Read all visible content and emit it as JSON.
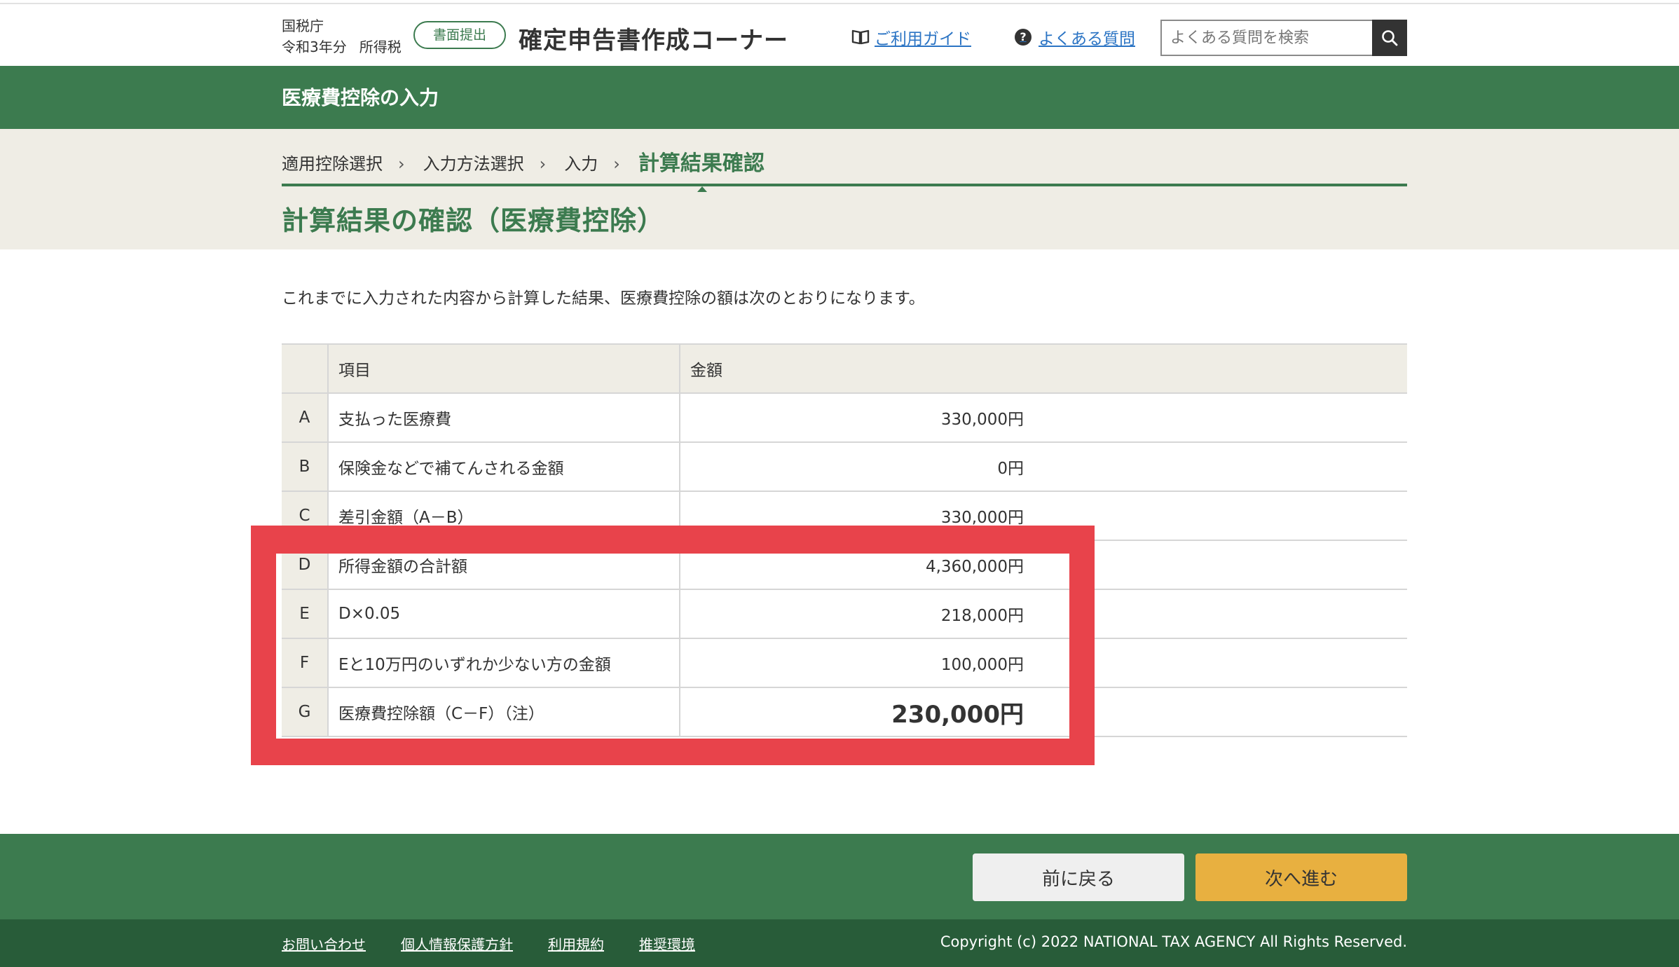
{
  "header": {
    "agency": "国税庁",
    "year": "令和3年分",
    "tax": "所得税",
    "badge": "書面提出",
    "title": "確定申告書作成コーナー",
    "guide_link": "ご利用ガイド",
    "faq_link": "よくある質問",
    "search_placeholder": "よくある質問を検索"
  },
  "banner": {
    "title": "医療費控除の入力"
  },
  "breadcrumb": [
    "適用控除選択",
    "入力方法選択",
    "入力",
    "計算結果確認"
  ],
  "page_title": "計算結果の確認（医療費控除）",
  "lead": "これまでに入力された内容から計算した結果、医療費控除の額は次のとおりになります。",
  "table": {
    "headers": {
      "item": "項目",
      "amount": "金額"
    },
    "rows": [
      {
        "key": "A",
        "item": "支払った医療費",
        "amount": "330,000円"
      },
      {
        "key": "B",
        "item": "保険金などで補てんされる金額",
        "amount": "0円"
      },
      {
        "key": "C",
        "item": "差引金額（A－B）",
        "amount": "330,000円"
      },
      {
        "key": "D",
        "item": "所得金額の合計額",
        "amount": "4,360,000円"
      },
      {
        "key": "E",
        "item": "D×0.05",
        "amount": "218,000円"
      },
      {
        "key": "F",
        "item": "Eと10万円のいずれか少ない方の金額",
        "amount": "100,000円"
      },
      {
        "key": "G",
        "item": "医療費控除額（C－F）（注）",
        "amount": "230,000円"
      }
    ]
  },
  "nav": {
    "back": "前に戻る",
    "next": "次へ進む"
  },
  "footer": {
    "links": [
      "お問い合わせ",
      "個人情報保護方針",
      "利用規約",
      "推奨環境"
    ],
    "copyright": "Copyright (c) 2022 NATIONAL TAX AGENCY All Rights Reserved."
  },
  "colors": {
    "green": "#3c7b4f",
    "dark_green": "#285c39",
    "beige": "#efede5",
    "highlight_red": "#e8434b",
    "next_button": "#e8b040"
  }
}
